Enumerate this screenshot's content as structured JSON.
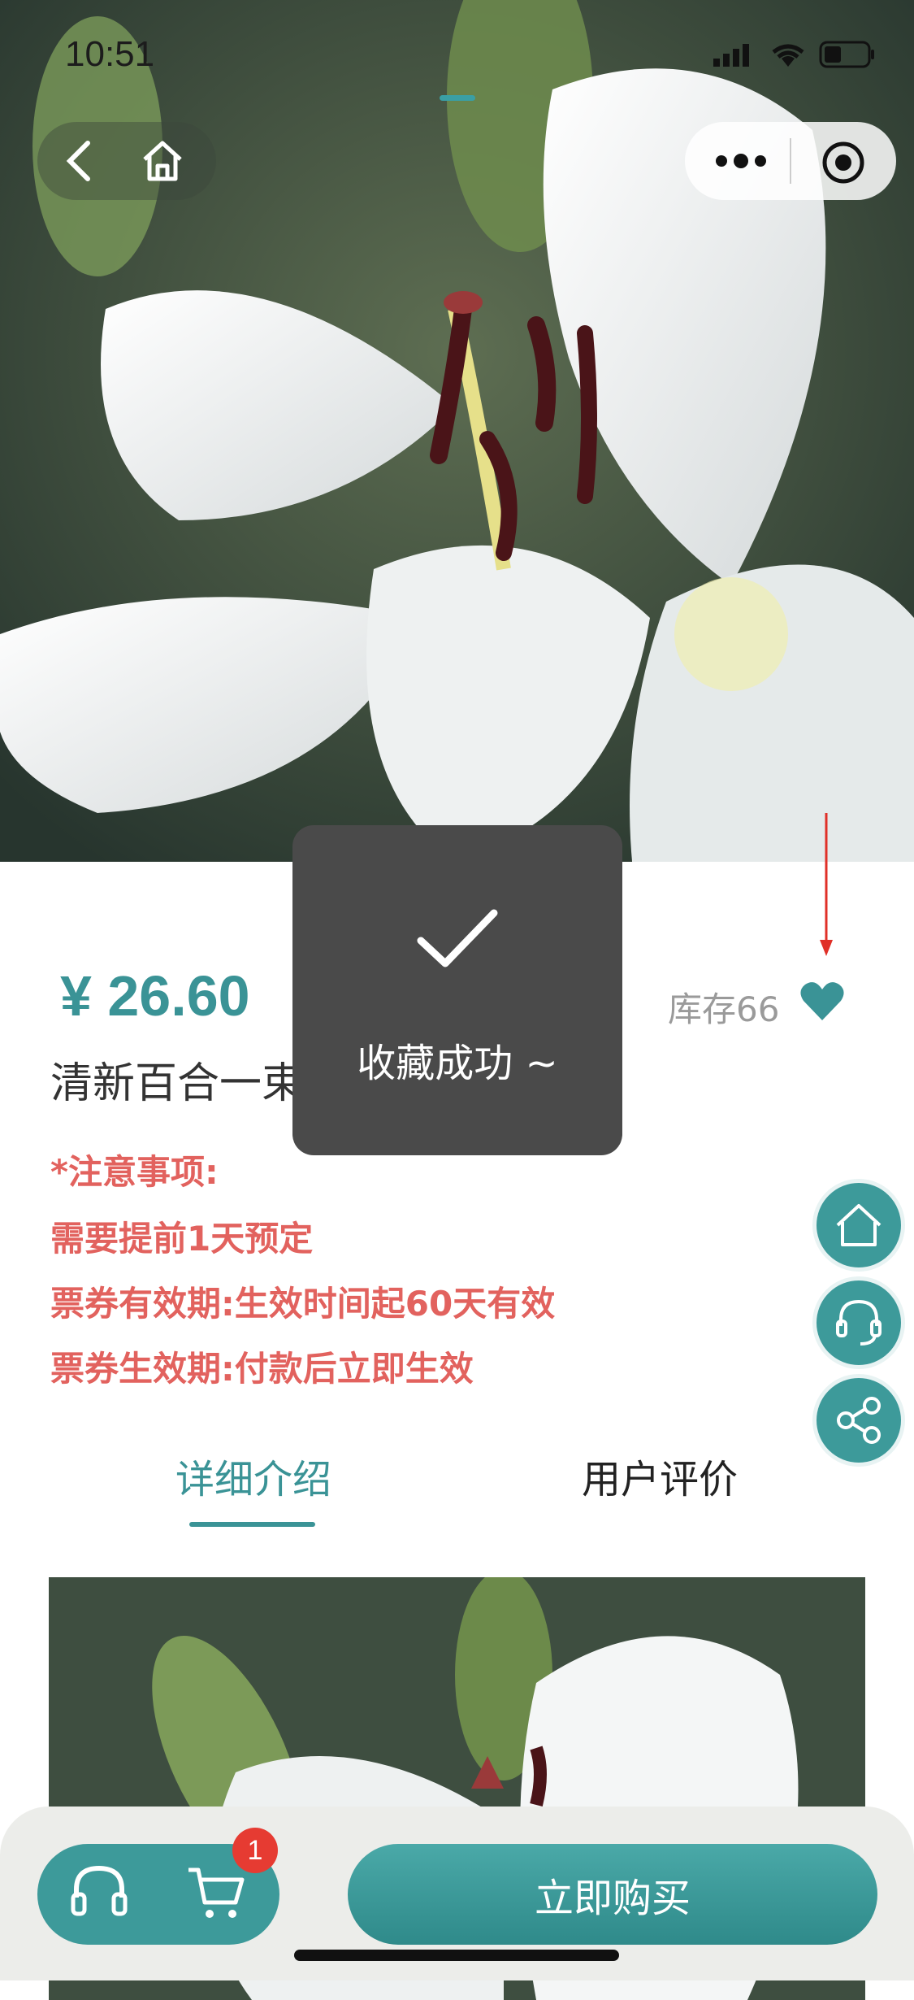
{
  "status_bar": {
    "time": "10:51"
  },
  "product": {
    "price": "¥ 26.60",
    "title": "清新百合一束",
    "stock": "库存66"
  },
  "notes": [
    "*注意事项:",
    "需要提前1天预定",
    "票券有效期:生效时间起60天有效",
    "票券生效期:付款后立即生效"
  ],
  "tabs": [
    {
      "label": "详细介绍",
      "active": true
    },
    {
      "label": "用户评价",
      "active": false
    }
  ],
  "toast": {
    "text": "收藏成功 ~"
  },
  "bottom_bar": {
    "buy_label": "立即购买",
    "cart_count": "1"
  },
  "colors": {
    "accent": "#3a9396",
    "warning": "#e2625e",
    "badge": "#e63b32"
  },
  "icons": [
    "back-icon",
    "home-icon",
    "more-icon",
    "target-icon",
    "heart-icon",
    "check-icon",
    "service-icon",
    "cart-icon",
    "share-icon"
  ]
}
